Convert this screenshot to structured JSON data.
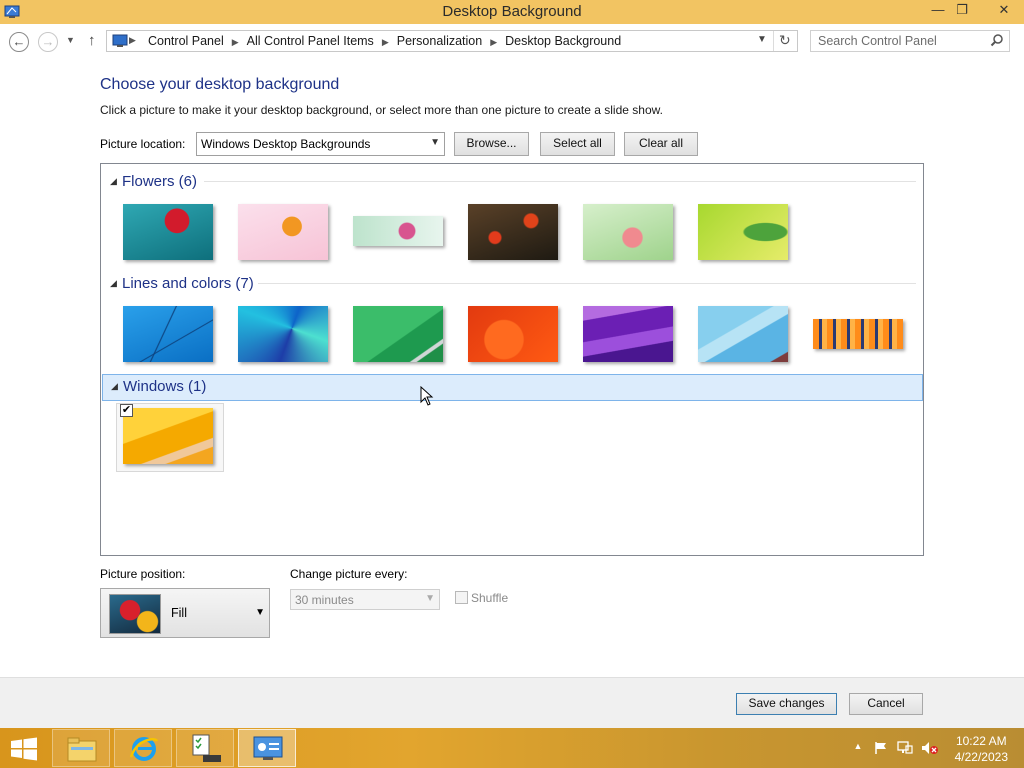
{
  "window": {
    "title": "Desktop Background",
    "min_glyph": "—",
    "max_glyph": "❐",
    "close_glyph": "✕"
  },
  "nav": {
    "breadcrumbs": [
      "Control Panel",
      "All Control Panel Items",
      "Personalization",
      "Desktop Background"
    ],
    "search_placeholder": "Search Control Panel"
  },
  "page": {
    "heading": "Choose your desktop background",
    "subtitle": "Click a picture to make it your desktop background, or select more than one picture to create a slide show.",
    "location_label": "Picture location:",
    "location_value": "Windows Desktop Backgrounds",
    "browse_label": "Browse...",
    "select_all_label": "Select all",
    "clear_all_label": "Clear all"
  },
  "groups": [
    {
      "name": "Flowers (6)",
      "thumbs": [
        "flower-red-teal",
        "flower-orange-pink",
        "flower-pink-mint",
        "flower-red-dark",
        "flower-pink-green",
        "leaf-yellow-green"
      ]
    },
    {
      "name": "Lines and colors (7)",
      "thumbs": [
        "lines-blue",
        "lines-blue-petals",
        "lines-green",
        "lines-orange-red",
        "lines-purple",
        "lines-light-blue",
        "lines-bars-orange"
      ]
    },
    {
      "name": "Windows (1)",
      "thumbs": [
        "windows-yellow"
      ],
      "selected": true
    }
  ],
  "bottom": {
    "position_label": "Picture position:",
    "position_value": "Fill",
    "interval_label": "Change picture every:",
    "interval_value": "30 minutes",
    "shuffle_label": "Shuffle",
    "save_label": "Save changes",
    "cancel_label": "Cancel"
  },
  "taskbar": {
    "time": "10:22 AM",
    "date": "4/22/2023"
  },
  "colors": {
    "title_bar": "#f2c462",
    "heading": "#1e3287",
    "taskbar": "#d8951c"
  }
}
